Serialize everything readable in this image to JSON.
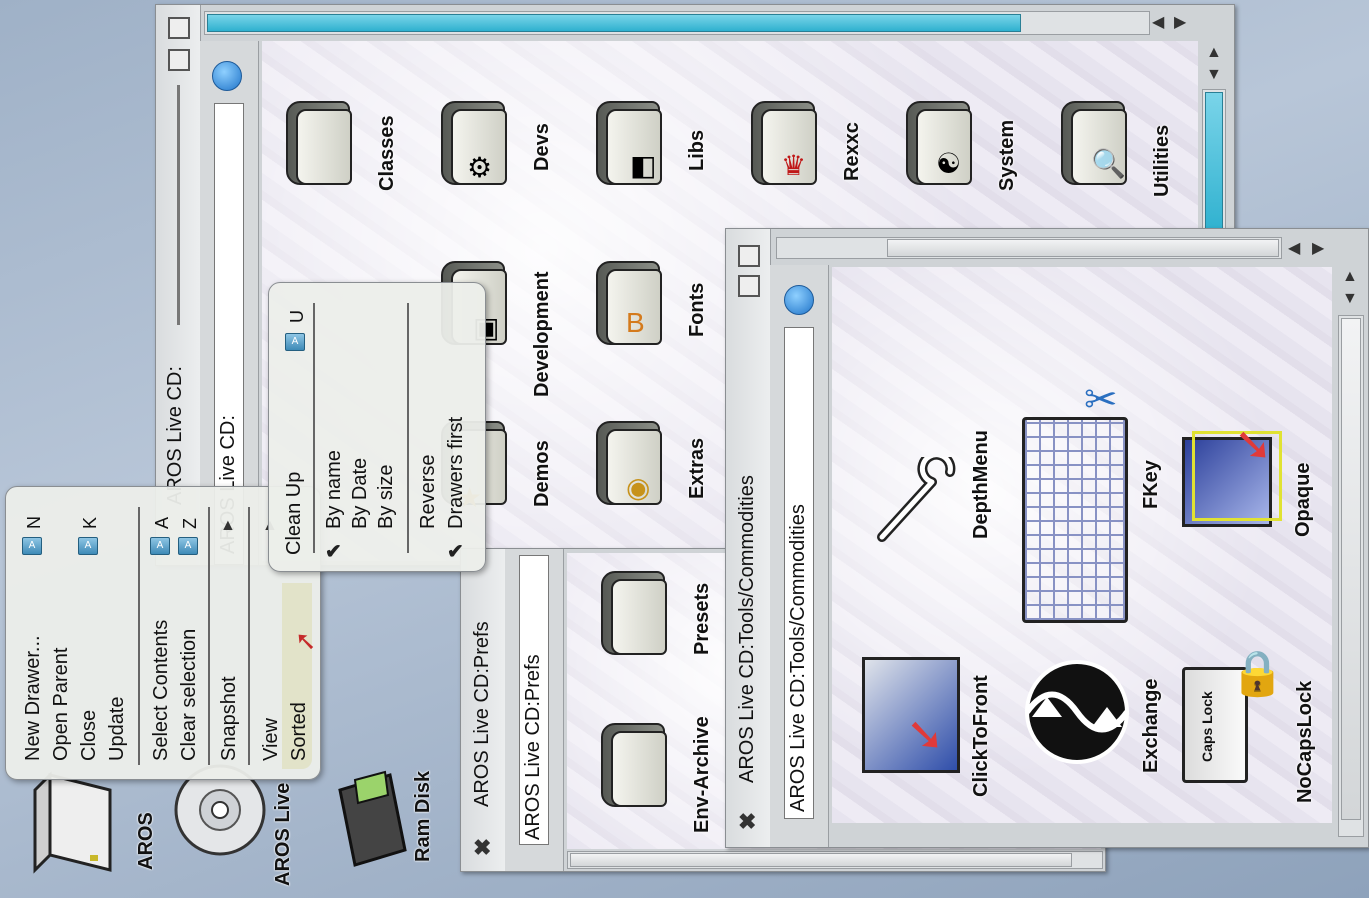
{
  "desktop": {
    "icons": [
      {
        "label": "AROS",
        "icon": "hard-disk-icon"
      },
      {
        "label": "AROS Live",
        "icon": "cd-icon"
      },
      {
        "label": "Ram Disk",
        "icon": "ram-disk-icon"
      }
    ]
  },
  "window_root": {
    "title": "AROS Live CD:",
    "path": "AROS Live CD:",
    "folders": [
      {
        "label": "Classes",
        "emblem": "none"
      },
      {
        "label": "Devs",
        "emblem": "gears-icon"
      },
      {
        "label": "Libs",
        "emblem": "puzzle-icon"
      },
      {
        "label": "Rexxc",
        "emblem": "rexx-icon"
      },
      {
        "label": "System",
        "emblem": "system-icon"
      },
      {
        "label": "Utilities",
        "emblem": "magnifier-icon"
      },
      {
        "label": "Development",
        "emblem": "box-icon"
      },
      {
        "label": "Fonts",
        "emblem": "font-icon"
      },
      {
        "label": "Demos",
        "emblem": "star-icon"
      },
      {
        "label": "Extras",
        "emblem": "disc-icon"
      }
    ]
  },
  "window_prefs": {
    "title": "AROS Live CD:Prefs",
    "path": "AROS Live CD:Prefs",
    "folders": [
      {
        "label": "Presets"
      },
      {
        "label": "Env-Archive"
      }
    ]
  },
  "window_commodities": {
    "title": "AROS Live CD:Tools/Commodities",
    "path": "AROS Live CD:Tools/Commodities",
    "items": [
      {
        "label": "DepthMenu",
        "icon": "wrench-icon"
      },
      {
        "label": "FKey",
        "icon": "keyboard-icon"
      },
      {
        "label": "Opaque",
        "icon": "opaque-window-icon"
      },
      {
        "label": "ClickToFront",
        "icon": "click-to-front-icon"
      },
      {
        "label": "Exchange",
        "icon": "exchange-icon"
      },
      {
        "label": "NoCapsLock",
        "icon": "caps-lock-icon"
      }
    ],
    "caps_lock_text": "Caps Lock"
  },
  "main_menu": {
    "items": [
      {
        "label": "New Drawer...",
        "shortcut": "N"
      },
      {
        "label": "Open Parent",
        "shortcut": ""
      },
      {
        "label": "Close",
        "shortcut": "K"
      },
      {
        "label": "Update",
        "shortcut": ""
      },
      {
        "label": "Select Contents",
        "shortcut": "A"
      },
      {
        "label": "Clear selection",
        "shortcut": "Z"
      },
      {
        "label": "Snapshot",
        "shortcut": ""
      },
      {
        "label": "View",
        "shortcut": ""
      },
      {
        "label": "Sorted",
        "shortcut": ""
      }
    ],
    "key_glyph": "A"
  },
  "sort_submenu": {
    "items": [
      {
        "label": "Clean Up",
        "shortcut": "U"
      },
      {
        "label": "By name"
      },
      {
        "label": "By Date"
      },
      {
        "label": "By size"
      },
      {
        "label": "Reverse"
      },
      {
        "label": "Drawers first"
      }
    ]
  },
  "colors": {
    "accent": "#2fb1cf",
    "menu_bg": "#eceeea",
    "window_bg": "#cfd3d6"
  }
}
